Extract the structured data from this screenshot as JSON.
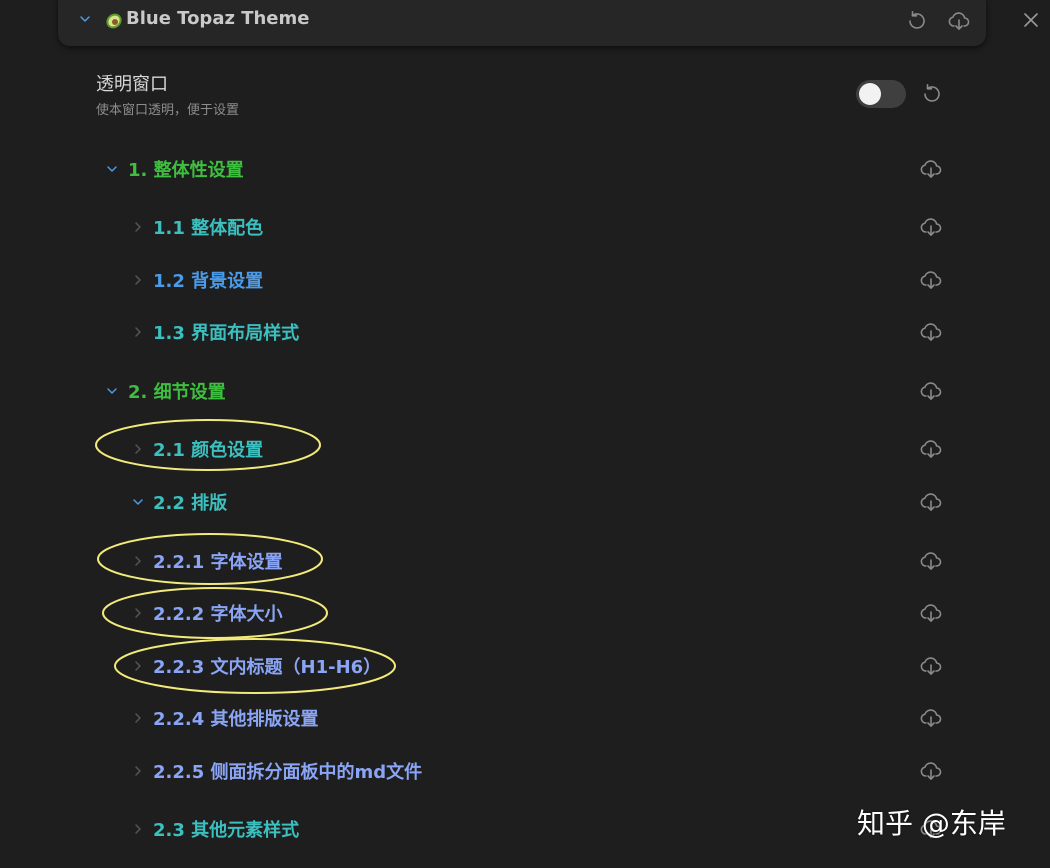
{
  "header": {
    "title": "Blue Topaz Theme",
    "icons": [
      "chevron-down-icon",
      "avocado-icon",
      "reset-icon",
      "cloud-download-icon",
      "close-icon"
    ]
  },
  "setting": {
    "name": "透明窗口",
    "description": "使本窗口透明，便于设置",
    "toggle_on": false
  },
  "sections": [
    {
      "label": "1. 整体性设置",
      "expanded": true
    },
    {
      "label": "1.1 整体配色",
      "expanded": false
    },
    {
      "label": "1.2 背景设置",
      "expanded": false
    },
    {
      "label": "1.3 界面布局样式",
      "expanded": false
    },
    {
      "label": "2. 细节设置",
      "expanded": true
    },
    {
      "label": "2.1 颜色设置",
      "expanded": false
    },
    {
      "label": "2.2 排版",
      "expanded": true
    },
    {
      "label": "2.2.1 字体设置",
      "expanded": false
    },
    {
      "label": "2.2.2 字体大小",
      "expanded": false
    },
    {
      "label": "2.2.3 文内标题（H1-H6）",
      "expanded": false
    },
    {
      "label": "2.2.4 其他排版设置",
      "expanded": false
    },
    {
      "label": "2.2.5 侧面拆分面板中的md文件",
      "expanded": false
    },
    {
      "label": "2.3 其他元素样式",
      "expanded": false
    }
  ],
  "watermark": "知乎 @东岸",
  "colors": {
    "background": "#1e1e1e",
    "level1": "#3fbf3f",
    "level2": "#3cbfbf",
    "level2_alt": "#4a9be8",
    "level3": "#8aa5f5",
    "highlight_ellipse": "#f2ea7a"
  }
}
